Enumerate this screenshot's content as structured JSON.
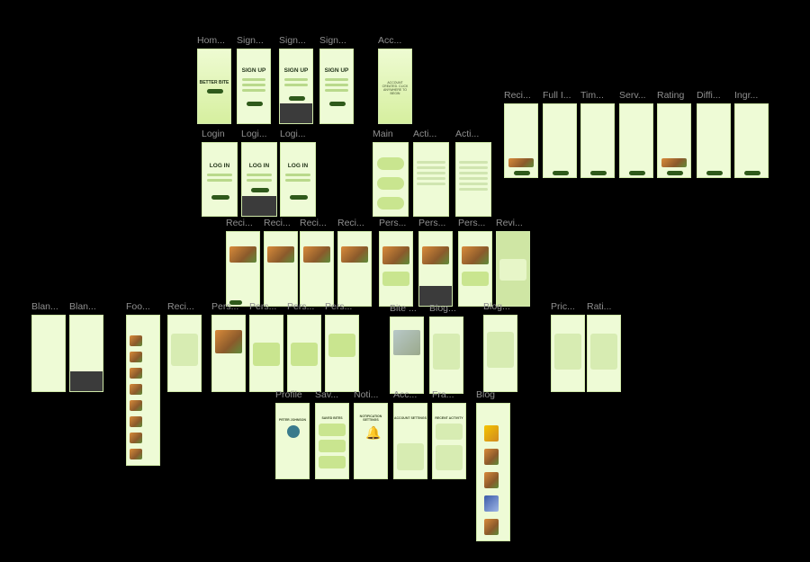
{
  "canvas": {
    "background": "#000000",
    "label_color": "#8f8f8f",
    "frame_bg": "#eefbd6",
    "accent": "#2f5a1b"
  },
  "frames": {
    "home": {
      "label": "Hom...",
      "title": "BETTER BITE"
    },
    "signup1": {
      "label": "Sign...",
      "title": "SIGN UP"
    },
    "signup2": {
      "label": "Sign...",
      "title": "SIGN UP"
    },
    "signup3": {
      "label": "Sign...",
      "title": "SIGN UP"
    },
    "acc_created": {
      "label": "Acc...",
      "text": "ACCOUNT CREATED. CLICK ANYWHERE TO BEGIN"
    },
    "login1": {
      "label": "Login",
      "title": "LOG IN"
    },
    "login2": {
      "label": "Logi...",
      "title": "LOG IN"
    },
    "login3": {
      "label": "Logi...",
      "title": "LOG IN"
    },
    "main": {
      "label": "Main"
    },
    "acti1": {
      "label": "Acti..."
    },
    "acti2": {
      "label": "Acti..."
    },
    "reci_a": {
      "label": "Reci..."
    },
    "full_l": {
      "label": "Full I..."
    },
    "tim": {
      "label": "Tim..."
    },
    "serv": {
      "label": "Serv..."
    },
    "rating": {
      "label": "Rating"
    },
    "diffi": {
      "label": "Diffi..."
    },
    "ingr": {
      "label": "Ingr..."
    },
    "reci1": {
      "label": "Reci..."
    },
    "reci2": {
      "label": "Reci..."
    },
    "reci3": {
      "label": "Reci..."
    },
    "reci4": {
      "label": "Reci..."
    },
    "pers1": {
      "label": "Pers..."
    },
    "pers2": {
      "label": "Pers..."
    },
    "pers3": {
      "label": "Pers..."
    },
    "revi": {
      "label": "Revi..."
    },
    "blan1": {
      "label": "Blan..."
    },
    "blan2": {
      "label": "Blan..."
    },
    "foo": {
      "label": "Foo..."
    },
    "reci5": {
      "label": "Reci..."
    },
    "pers4": {
      "label": "Pers..."
    },
    "pers5": {
      "label": "Pers..."
    },
    "pers6": {
      "label": "Pers..."
    },
    "pers7": {
      "label": "Pers..."
    },
    "bite": {
      "label": "Bite ..."
    },
    "blog1": {
      "label": "Blog..."
    },
    "blog2": {
      "label": "Blog..."
    },
    "pric": {
      "label": "Pric..."
    },
    "rati": {
      "label": "Rati..."
    },
    "profile": {
      "label": "Profile",
      "title": "PETER JOHNSON"
    },
    "sav": {
      "label": "Sav...",
      "title": "SAVED BITES"
    },
    "noti": {
      "label": "Noti...",
      "title": "NOTIFICATION SETTINGS"
    },
    "acc2": {
      "label": "Acc...",
      "title": "ACCOUNT SETTINGS"
    },
    "fra": {
      "label": "Fra...",
      "title": "RECENT ACTIVITY"
    },
    "blog3": {
      "label": "Blog"
    }
  }
}
